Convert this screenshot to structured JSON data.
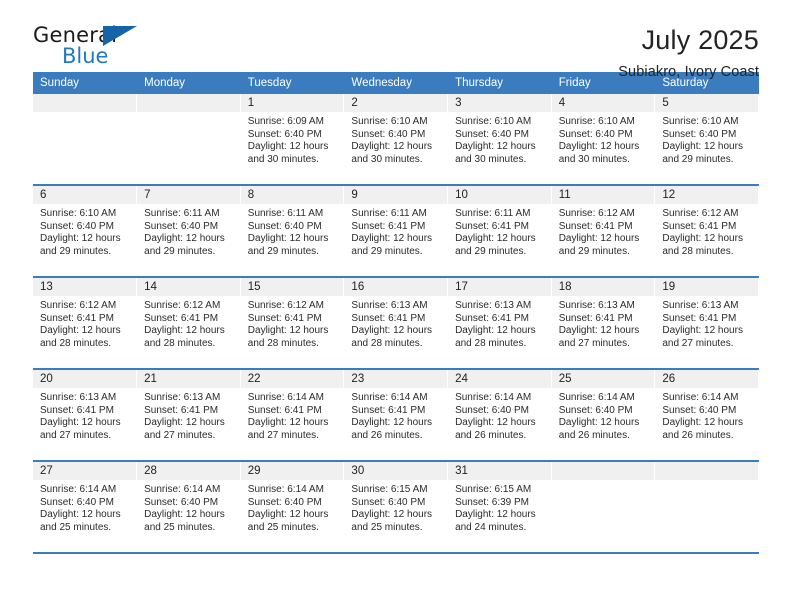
{
  "brand": {
    "name_top": "General",
    "name_bottom": "Blue",
    "triangle_color": "#1664a8",
    "blue_text_color": "#1f7ac0"
  },
  "header": {
    "title": "July 2025",
    "subtitle": "Subiakro, Ivory Coast"
  },
  "theme": {
    "header_band": "#3a7cbe",
    "daynum_bg": "#f0f0f0",
    "text": "#222222"
  },
  "weekdays": [
    "Sunday",
    "Monday",
    "Tuesday",
    "Wednesday",
    "Thursday",
    "Friday",
    "Saturday"
  ],
  "labels": {
    "sunrise": "Sunrise:",
    "sunset": "Sunset:",
    "daylight": "Daylight:"
  },
  "weeks": [
    [
      {
        "day": "",
        "sunrise": "",
        "sunset": "",
        "daylight_1": "",
        "daylight_2": ""
      },
      {
        "day": "",
        "sunrise": "",
        "sunset": "",
        "daylight_1": "",
        "daylight_2": ""
      },
      {
        "day": "1",
        "sunrise": "Sunrise: 6:09 AM",
        "sunset": "Sunset: 6:40 PM",
        "daylight_1": "Daylight: 12 hours",
        "daylight_2": "and 30 minutes."
      },
      {
        "day": "2",
        "sunrise": "Sunrise: 6:10 AM",
        "sunset": "Sunset: 6:40 PM",
        "daylight_1": "Daylight: 12 hours",
        "daylight_2": "and 30 minutes."
      },
      {
        "day": "3",
        "sunrise": "Sunrise: 6:10 AM",
        "sunset": "Sunset: 6:40 PM",
        "daylight_1": "Daylight: 12 hours",
        "daylight_2": "and 30 minutes."
      },
      {
        "day": "4",
        "sunrise": "Sunrise: 6:10 AM",
        "sunset": "Sunset: 6:40 PM",
        "daylight_1": "Daylight: 12 hours",
        "daylight_2": "and 30 minutes."
      },
      {
        "day": "5",
        "sunrise": "Sunrise: 6:10 AM",
        "sunset": "Sunset: 6:40 PM",
        "daylight_1": "Daylight: 12 hours",
        "daylight_2": "and 29 minutes."
      }
    ],
    [
      {
        "day": "6",
        "sunrise": "Sunrise: 6:10 AM",
        "sunset": "Sunset: 6:40 PM",
        "daylight_1": "Daylight: 12 hours",
        "daylight_2": "and 29 minutes."
      },
      {
        "day": "7",
        "sunrise": "Sunrise: 6:11 AM",
        "sunset": "Sunset: 6:40 PM",
        "daylight_1": "Daylight: 12 hours",
        "daylight_2": "and 29 minutes."
      },
      {
        "day": "8",
        "sunrise": "Sunrise: 6:11 AM",
        "sunset": "Sunset: 6:40 PM",
        "daylight_1": "Daylight: 12 hours",
        "daylight_2": "and 29 minutes."
      },
      {
        "day": "9",
        "sunrise": "Sunrise: 6:11 AM",
        "sunset": "Sunset: 6:41 PM",
        "daylight_1": "Daylight: 12 hours",
        "daylight_2": "and 29 minutes."
      },
      {
        "day": "10",
        "sunrise": "Sunrise: 6:11 AM",
        "sunset": "Sunset: 6:41 PM",
        "daylight_1": "Daylight: 12 hours",
        "daylight_2": "and 29 minutes."
      },
      {
        "day": "11",
        "sunrise": "Sunrise: 6:12 AM",
        "sunset": "Sunset: 6:41 PM",
        "daylight_1": "Daylight: 12 hours",
        "daylight_2": "and 29 minutes."
      },
      {
        "day": "12",
        "sunrise": "Sunrise: 6:12 AM",
        "sunset": "Sunset: 6:41 PM",
        "daylight_1": "Daylight: 12 hours",
        "daylight_2": "and 28 minutes."
      }
    ],
    [
      {
        "day": "13",
        "sunrise": "Sunrise: 6:12 AM",
        "sunset": "Sunset: 6:41 PM",
        "daylight_1": "Daylight: 12 hours",
        "daylight_2": "and 28 minutes."
      },
      {
        "day": "14",
        "sunrise": "Sunrise: 6:12 AM",
        "sunset": "Sunset: 6:41 PM",
        "daylight_1": "Daylight: 12 hours",
        "daylight_2": "and 28 minutes."
      },
      {
        "day": "15",
        "sunrise": "Sunrise: 6:12 AM",
        "sunset": "Sunset: 6:41 PM",
        "daylight_1": "Daylight: 12 hours",
        "daylight_2": "and 28 minutes."
      },
      {
        "day": "16",
        "sunrise": "Sunrise: 6:13 AM",
        "sunset": "Sunset: 6:41 PM",
        "daylight_1": "Daylight: 12 hours",
        "daylight_2": "and 28 minutes."
      },
      {
        "day": "17",
        "sunrise": "Sunrise: 6:13 AM",
        "sunset": "Sunset: 6:41 PM",
        "daylight_1": "Daylight: 12 hours",
        "daylight_2": "and 28 minutes."
      },
      {
        "day": "18",
        "sunrise": "Sunrise: 6:13 AM",
        "sunset": "Sunset: 6:41 PM",
        "daylight_1": "Daylight: 12 hours",
        "daylight_2": "and 27 minutes."
      },
      {
        "day": "19",
        "sunrise": "Sunrise: 6:13 AM",
        "sunset": "Sunset: 6:41 PM",
        "daylight_1": "Daylight: 12 hours",
        "daylight_2": "and 27 minutes."
      }
    ],
    [
      {
        "day": "20",
        "sunrise": "Sunrise: 6:13 AM",
        "sunset": "Sunset: 6:41 PM",
        "daylight_1": "Daylight: 12 hours",
        "daylight_2": "and 27 minutes."
      },
      {
        "day": "21",
        "sunrise": "Sunrise: 6:13 AM",
        "sunset": "Sunset: 6:41 PM",
        "daylight_1": "Daylight: 12 hours",
        "daylight_2": "and 27 minutes."
      },
      {
        "day": "22",
        "sunrise": "Sunrise: 6:14 AM",
        "sunset": "Sunset: 6:41 PM",
        "daylight_1": "Daylight: 12 hours",
        "daylight_2": "and 27 minutes."
      },
      {
        "day": "23",
        "sunrise": "Sunrise: 6:14 AM",
        "sunset": "Sunset: 6:41 PM",
        "daylight_1": "Daylight: 12 hours",
        "daylight_2": "and 26 minutes."
      },
      {
        "day": "24",
        "sunrise": "Sunrise: 6:14 AM",
        "sunset": "Sunset: 6:40 PM",
        "daylight_1": "Daylight: 12 hours",
        "daylight_2": "and 26 minutes."
      },
      {
        "day": "25",
        "sunrise": "Sunrise: 6:14 AM",
        "sunset": "Sunset: 6:40 PM",
        "daylight_1": "Daylight: 12 hours",
        "daylight_2": "and 26 minutes."
      },
      {
        "day": "26",
        "sunrise": "Sunrise: 6:14 AM",
        "sunset": "Sunset: 6:40 PM",
        "daylight_1": "Daylight: 12 hours",
        "daylight_2": "and 26 minutes."
      }
    ],
    [
      {
        "day": "27",
        "sunrise": "Sunrise: 6:14 AM",
        "sunset": "Sunset: 6:40 PM",
        "daylight_1": "Daylight: 12 hours",
        "daylight_2": "and 25 minutes."
      },
      {
        "day": "28",
        "sunrise": "Sunrise: 6:14 AM",
        "sunset": "Sunset: 6:40 PM",
        "daylight_1": "Daylight: 12 hours",
        "daylight_2": "and 25 minutes."
      },
      {
        "day": "29",
        "sunrise": "Sunrise: 6:14 AM",
        "sunset": "Sunset: 6:40 PM",
        "daylight_1": "Daylight: 12 hours",
        "daylight_2": "and 25 minutes."
      },
      {
        "day": "30",
        "sunrise": "Sunrise: 6:15 AM",
        "sunset": "Sunset: 6:40 PM",
        "daylight_1": "Daylight: 12 hours",
        "daylight_2": "and 25 minutes."
      },
      {
        "day": "31",
        "sunrise": "Sunrise: 6:15 AM",
        "sunset": "Sunset: 6:39 PM",
        "daylight_1": "Daylight: 12 hours",
        "daylight_2": "and 24 minutes."
      },
      {
        "day": "",
        "sunrise": "",
        "sunset": "",
        "daylight_1": "",
        "daylight_2": ""
      },
      {
        "day": "",
        "sunrise": "",
        "sunset": "",
        "daylight_1": "",
        "daylight_2": ""
      }
    ]
  ]
}
